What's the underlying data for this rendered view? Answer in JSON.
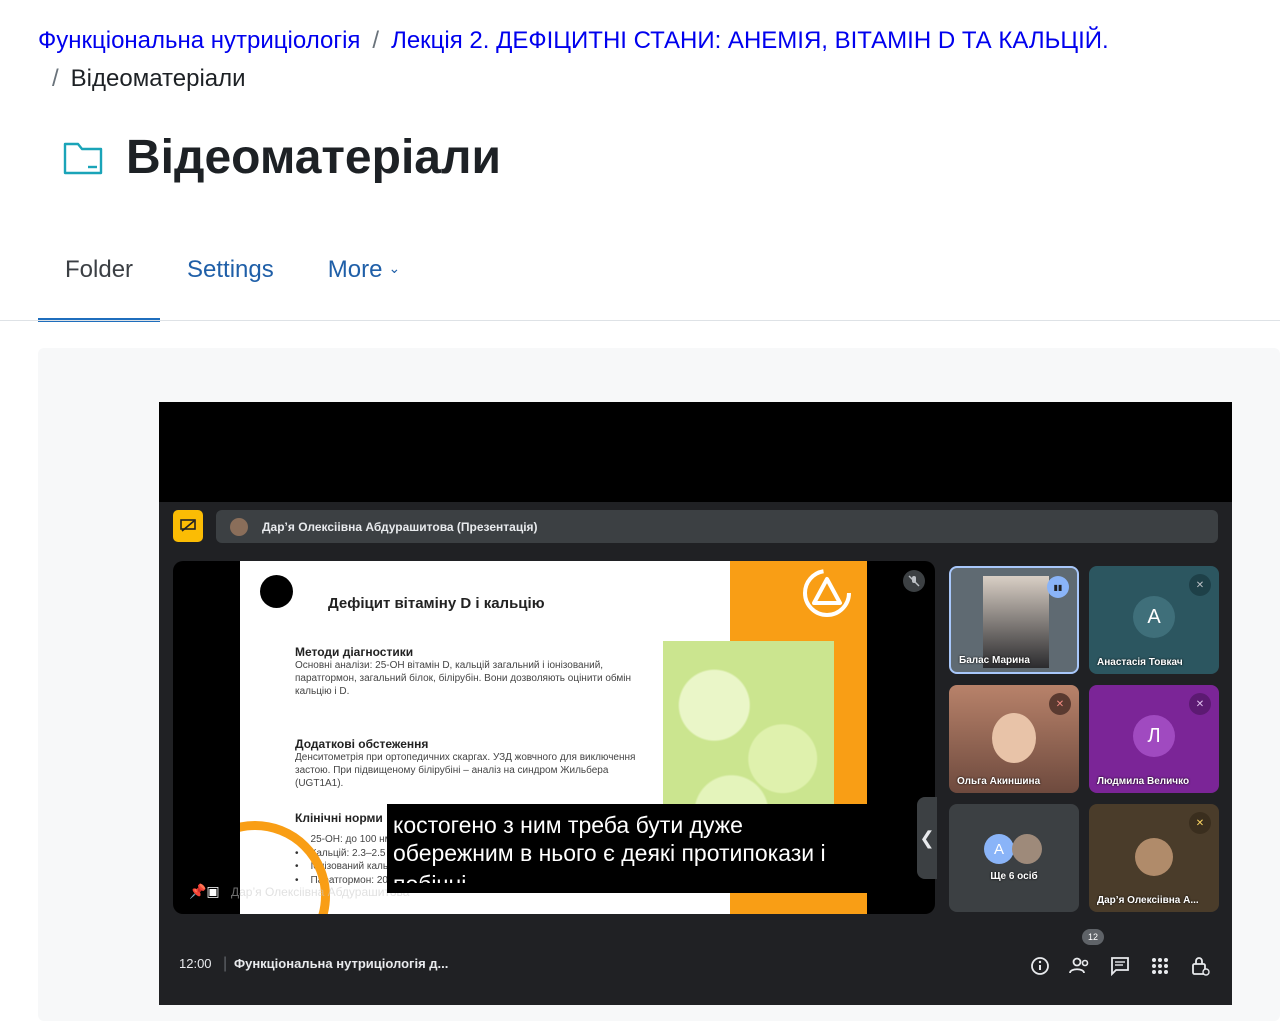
{
  "breadcrumb": {
    "course": "Функціональна нутриціологія",
    "lecture": "Лекція 2. ДЕФІЦИТНІ СТАНИ: АНЕМІЯ, ВІТАМІН D ТА КАЛЬЦІЙ.",
    "current": "Відеоматеріали",
    "separator": "/"
  },
  "page": {
    "title": "Відеоматеріали",
    "icon": "folder-icon"
  },
  "tabs": {
    "folder": "Folder",
    "settings": "Settings",
    "more": "More"
  },
  "meet": {
    "presenter_bar": "Дар’я Олексіівна Абдурашитова (Презентація)",
    "presenter_name": "Дар’я Олексіівна Абдурашитова",
    "slide": {
      "title": "Дефіцит вітаміну D і кальцію",
      "section1_title": "Методи діагностики",
      "section1_text": "Основні аналізи: 25-OH вітамін D, кальцій загальний і іонізований, паратгормон, загальний білок, білірубін. Вони дозволяють оцінити обмін кальцію і D.",
      "section2_title": "Додаткові обстеження",
      "section2_text": "Денситометрія при ортопедичних скаргах. УЗД жовчного для виключення застою. При підвищеному білірубіні – аналіз на синдром Жильбера (UGT1A1).",
      "section3_title": "Клінічні норми",
      "norms": [
        "25-OH: до 100 нмоль/л.",
        "Кальцій: 2.3–2.5 ммоль/л.",
        "Іонізований кальцій: 1.20–1.35 ммоль/л.",
        "Паратгормон: 20–88 пг/мл."
      ]
    },
    "participants": [
      {
        "name": "Балас Марина",
        "initial": ""
      },
      {
        "name": "Анастасія Товкач",
        "initial": "А"
      },
      {
        "name": "Ольга Акиншина",
        "initial": ""
      },
      {
        "name": "Людмила Величко",
        "initial": "Л"
      },
      {
        "name": "Ще 6 осіб",
        "initial": "А"
      },
      {
        "name": "Дар’я Олексіівна А...",
        "initial": ""
      }
    ],
    "time": "12:00",
    "meeting_title": "Функціональна нутриціологія д...",
    "caption_lines": [
      "костогено з ним треба бути дуже",
      "обережним в нього є деякі протипокази і",
      "побічні"
    ],
    "people_count": "12",
    "colors": {
      "accent": "#fbbc04",
      "panel": "#202124",
      "slide_orange": "#f99e15",
      "link": "#1f5fa8"
    }
  }
}
